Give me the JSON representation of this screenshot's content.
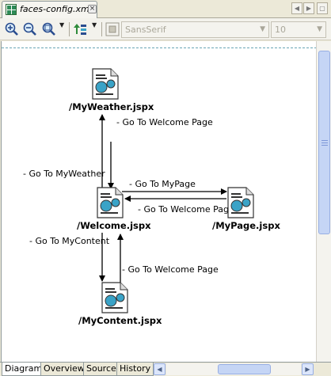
{
  "editor_tab": {
    "label": "faces-config.xml"
  },
  "toolbar": {
    "font_family": "SansSerif",
    "font_size": "10",
    "icons": [
      "zoom-in-icon",
      "zoom-out-icon",
      "zoom-fit-icon",
      "publish-icon",
      "color-icon"
    ]
  },
  "diagram": {
    "nodes": {
      "weather": "/MyWeather.jspx",
      "welcome": "/Welcome.jspx",
      "mypage": "/MyPage.jspx",
      "mycontent": "/MyContent.jspx"
    },
    "edges": {
      "weather_to_welcome": "- Go To Welcome Page",
      "welcome_to_weather": "- Go To MyWeather",
      "welcome_to_mypage": "- Go To MyPage",
      "mypage_to_welcome": "- Go To Welcome Page",
      "welcome_to_mycontent": "- Go To MyContent",
      "mycontent_to_welcome": "- Go To Welcome Page"
    }
  },
  "bottom_tabs": [
    "Diagram",
    "Overview",
    "Source",
    "History"
  ],
  "active_tab": "Diagram",
  "colors": {
    "accent": "#3aa3c7",
    "tab_bg": "#ece9d8"
  }
}
